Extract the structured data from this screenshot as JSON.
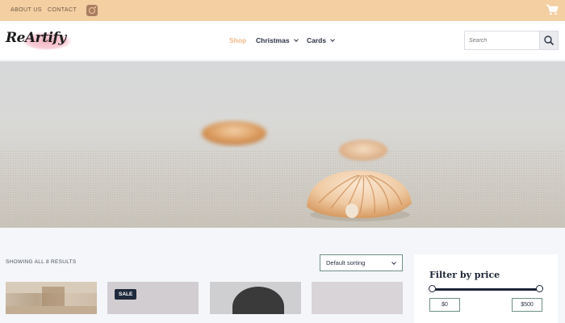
{
  "topbar": {
    "about_label": "ABOUT US",
    "contact_label": "CONTACT",
    "social_icon": "instagram-icon",
    "cart_icon": "cart-icon",
    "background": "#f3cfa2"
  },
  "header": {
    "logo_text": "ReArtify",
    "menu": [
      {
        "label": "Shop",
        "active": true
      },
      {
        "label": "Christmas",
        "has_dropdown": true
      },
      {
        "label": "Cards",
        "has_dropdown": true
      }
    ],
    "search": {
      "placeholder": "Search",
      "button_icon": "search-icon"
    },
    "active_color": "#f0b989"
  },
  "hero": {
    "image": "seashells-on-sand"
  },
  "shop": {
    "result_count": "SHOWING ALL 8 RESULTS",
    "sort_value": "Default sorting",
    "products": [
      {
        "image": "wooden-crafts"
      },
      {
        "image": "product-2",
        "badge": "SALE"
      },
      {
        "image": "product-3-dark-hair"
      },
      {
        "image": "product-4"
      }
    ]
  },
  "filter": {
    "title": "Filter by price",
    "min_price": "$0",
    "max_price": "$500"
  }
}
